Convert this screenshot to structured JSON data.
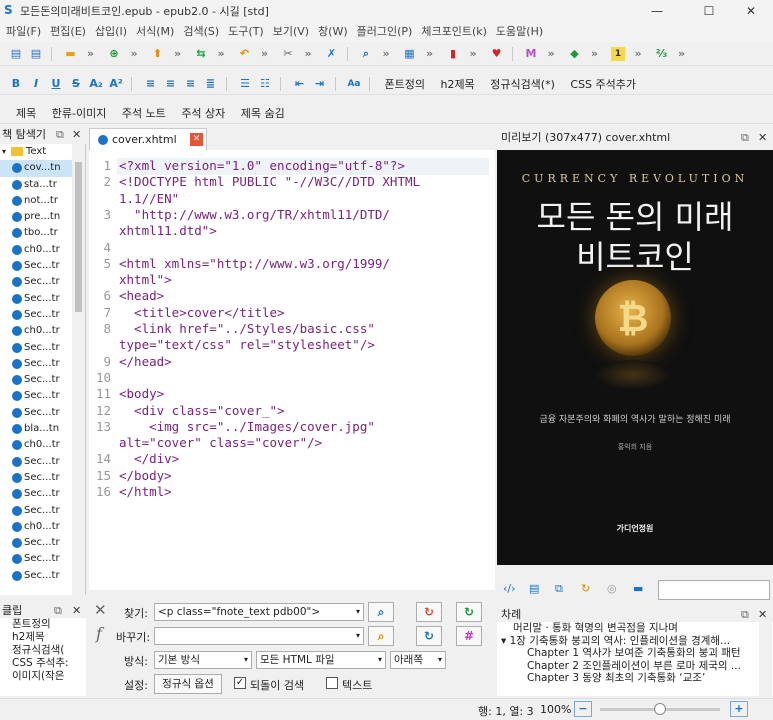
{
  "window": {
    "title": "모든돈의미래비트코인.epub - epub2.0 - 시길 [std]",
    "minimize": "—",
    "maximize": "☐",
    "close": "✕"
  },
  "menu": [
    "파일(F)",
    "편집(E)",
    "삽입(I)",
    "서식(M)",
    "검색(S)",
    "도구(T)",
    "보기(V)",
    "창(W)",
    "플러그인(P)",
    "체크포인트(k)",
    "도움말(H)"
  ],
  "format_toolbar": {
    "font_def": "폰트정의",
    "h2": "h2제목",
    "regex": "정규식검색(*)",
    "css_note": "CSS 주석추가"
  },
  "clip_toolbar": [
    "제목",
    "한류-이미지",
    "주석 노트",
    "주석 상자",
    "제목 숨김"
  ],
  "browser": {
    "title": "책 탐색기",
    "folder": "Text",
    "files": [
      "cov...tn",
      "sta...tr",
      "not...tr",
      "pre...tn",
      "tbo...tr",
      "ch0...tr",
      "Sec...tr",
      "Sec...tr",
      "Sec...tr",
      "Sec...tr",
      "ch0...tr",
      "Sec...tr",
      "Sec...tr",
      "Sec...tr",
      "Sec...tr",
      "Sec...tr",
      "bla...tn",
      "ch0...tr",
      "Sec...tr",
      "Sec...tr",
      "Sec...tr",
      "Sec...tr",
      "ch0...tr",
      "Sec...tr",
      "Sec...tr",
      "Sec...tr"
    ]
  },
  "editor": {
    "tab": "cover.xhtml",
    "lines": [
      {
        "n": "1",
        "t": "<?xml version=\"1.0\" encoding=\"utf-8\"?>"
      },
      {
        "n": "2",
        "t": "<!DOCTYPE html PUBLIC \"-//W3C//DTD XHTML"
      },
      {
        "n": "",
        "t": "1.1//EN\""
      },
      {
        "n": "3",
        "t": "  \"http://www.w3.org/TR/xhtml11/DTD/"
      },
      {
        "n": "",
        "t": "xhtml11.dtd\">"
      },
      {
        "n": "4",
        "t": ""
      },
      {
        "n": "5",
        "t": "<html xmlns=\"http://www.w3.org/1999/"
      },
      {
        "n": "",
        "t": "xhtml\">"
      },
      {
        "n": "6",
        "t": "<head>"
      },
      {
        "n": "7",
        "t": "  <title>cover</title>"
      },
      {
        "n": "8",
        "t": "  <link href=\"../Styles/basic.css\""
      },
      {
        "n": "",
        "t": "type=\"text/css\" rel=\"stylesheet\"/>"
      },
      {
        "n": "9",
        "t": "</head>"
      },
      {
        "n": "10",
        "t": ""
      },
      {
        "n": "11",
        "t": "<body>"
      },
      {
        "n": "12",
        "t": "  <div class=\"cover_\">"
      },
      {
        "n": "13",
        "t": "    <img src=\"../Images/cover.jpg\""
      },
      {
        "n": "",
        "t": "alt=\"cover\" class=\"cover\"/>"
      },
      {
        "n": "14",
        "t": "  </div>"
      },
      {
        "n": "15",
        "t": "</body>"
      },
      {
        "n": "16",
        "t": "</html>"
      }
    ]
  },
  "preview": {
    "header": "미리보기 (307x477) cover.xhtml",
    "kicker": "CURRENCY REVOLUTION",
    "title1": "모든 돈의 미래",
    "title2": "비트코인",
    "subtitle": "금융 자본주의와 화폐의 역사가 말하는 정해진 미래",
    "author": "홍익희 지음",
    "publisher": "가디언정원"
  },
  "clip": {
    "title": "클립",
    "items": [
      "폰트정의",
      "h2제목",
      "정규식검색(",
      "CSS 주석추:",
      "이미지(작은"
    ]
  },
  "find": {
    "find_label": "찾기:",
    "find_value": "<p class=\"fnote_text pdb00\">",
    "replace_label": "바꾸기:",
    "replace_value": "",
    "mode_label": "방식:",
    "mode_value": "기본 방식",
    "scope_value": "모든 HTML 파일",
    "direction_value": "아래쪽",
    "settings_label": "설정:",
    "regex_btn": "정규식 옵션",
    "wrap_label": "되돌이 검색",
    "wrap_checked": true,
    "text_label": "텍스트",
    "text_checked": false
  },
  "toc": {
    "title": "차례",
    "rows": [
      "머리말 · 통화 혁명의 변곡점을 지나며",
      "▾ 1장 기축통화 붕괴의 역사: 인플레이션을 경계해...",
      "Chapter 1 역사가 보여준 기축통화의 붕괴 패턴",
      "Chapter 2 조인플레이션이 부른 로마 제국의 ...",
      "Chapter 3 동양 최초의 기축통화 ‘교조’"
    ]
  },
  "status": {
    "position": "행: 1, 열: 3",
    "zoom": "100%"
  }
}
